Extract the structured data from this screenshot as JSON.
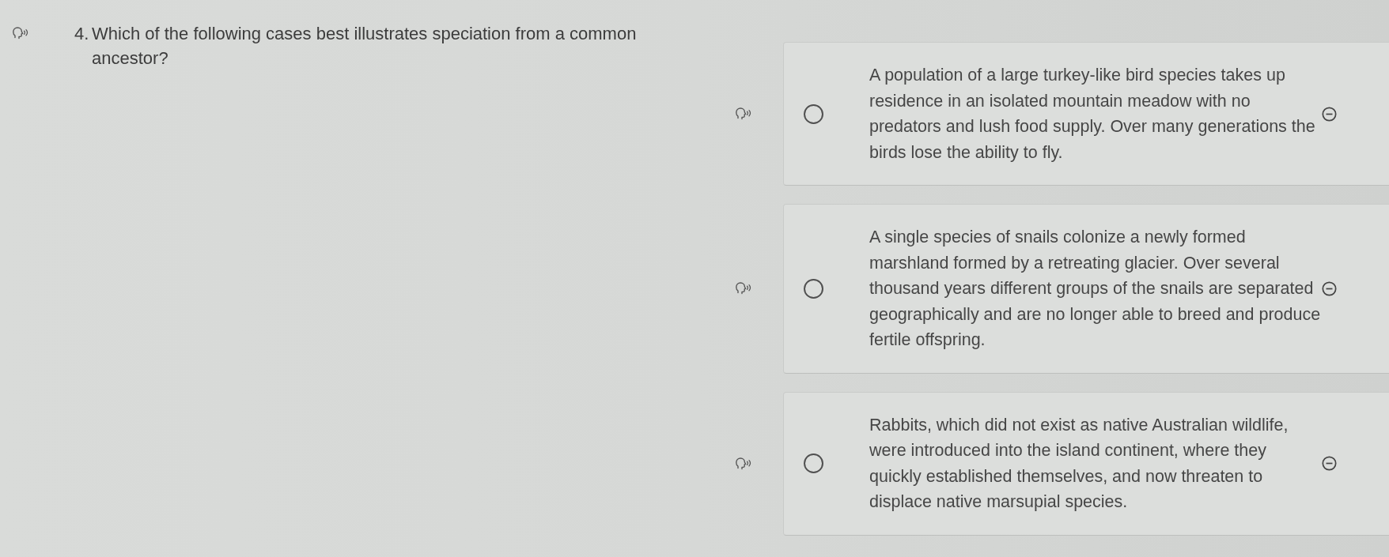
{
  "question": {
    "number": "4.",
    "text": "Which of the following cases best illustrates speciation from a common ancestor?"
  },
  "options": [
    {
      "text": "A population of a large turkey-like bird species takes up residence in an isolated mountain meadow with no predators and lush food supply. Over many generations the birds lose the ability to fly.",
      "selected": false
    },
    {
      "text": "A single species of snails colonize a newly formed marshland formed by a retreating glacier. Over several thousand years different groups of the snails are separated geographically and are no longer able to breed and produce fertile offspring.",
      "selected": false
    },
    {
      "text": "Rabbits, which did not exist as native Australian wildlife, were introduced into the island continent, where they quickly established themselves, and now threaten to displace native marsupial species.",
      "selected": false
    }
  ]
}
